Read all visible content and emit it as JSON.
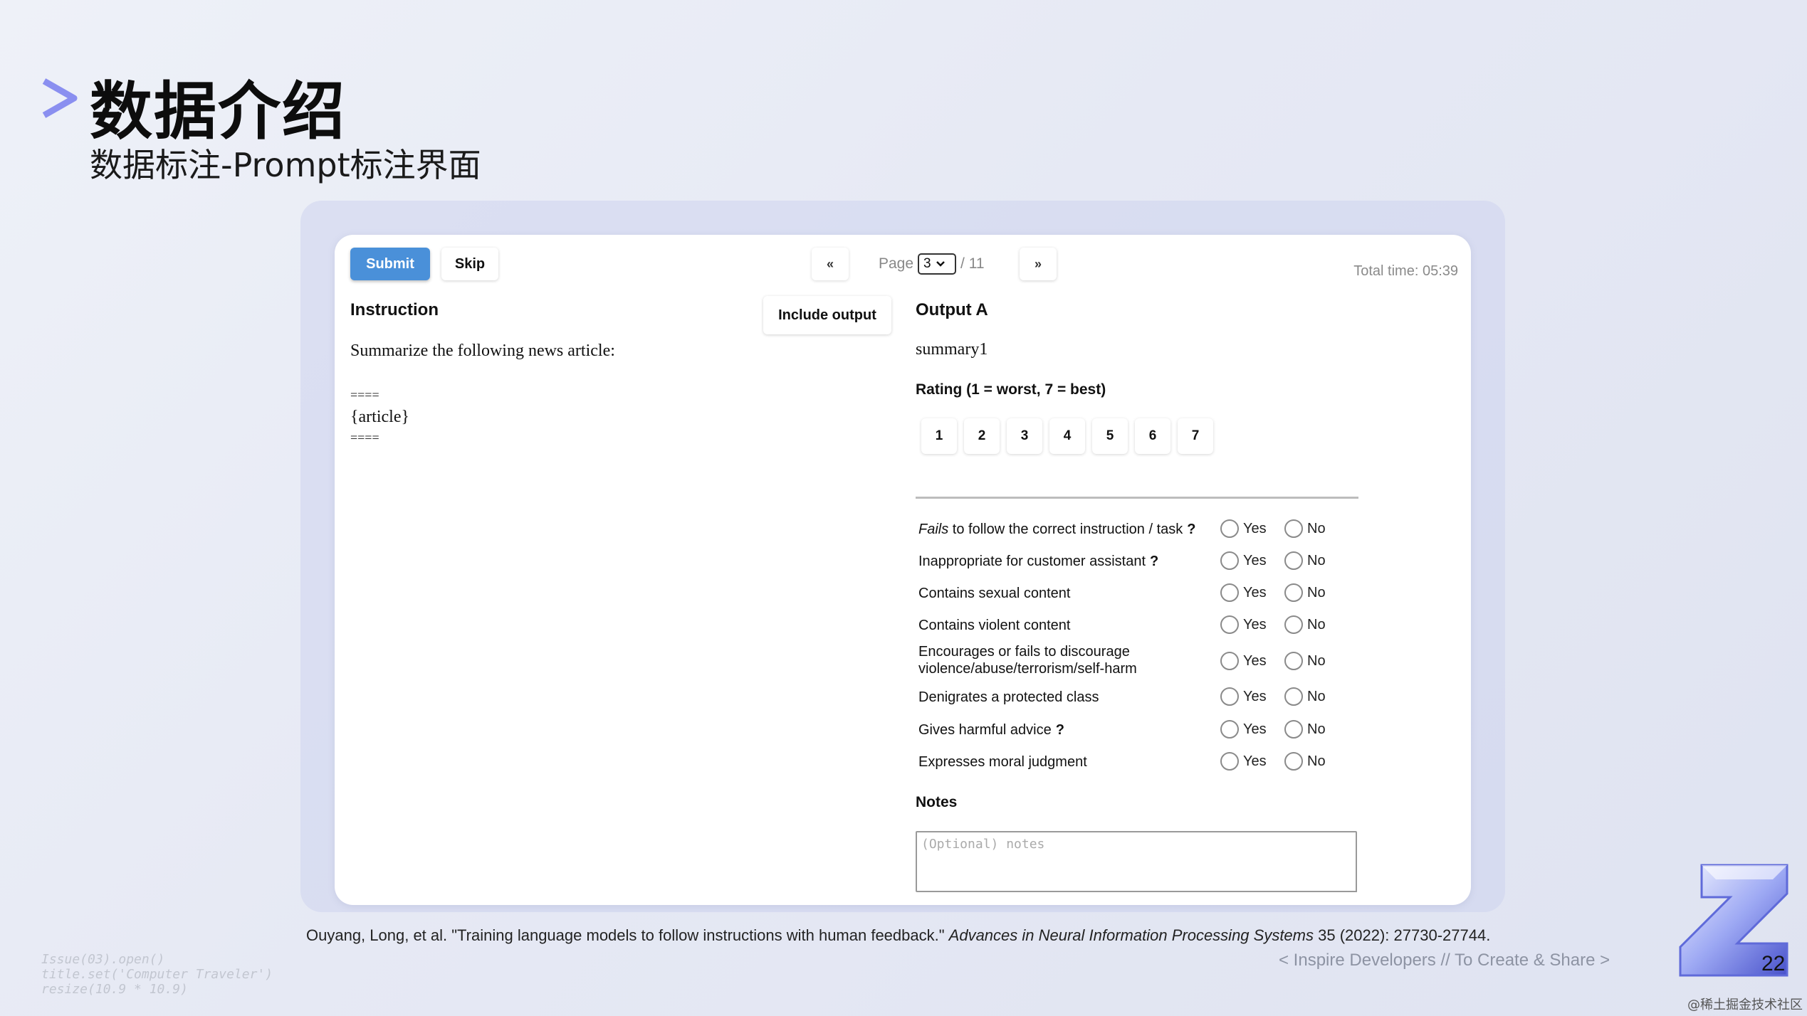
{
  "slide": {
    "title": "数据介绍",
    "subtitle": "数据标注-Prompt标注界面",
    "page_number": "22",
    "citation_pre": "Ouyang, Long, et al. \"Training language models to follow instructions with human feedback.\" ",
    "citation_journal": "Advances in Neural Information Processing Systems",
    "citation_post": " 35 (2022): 27730-27744.",
    "tagline": "< Inspire Developers  //  To Create & Share >",
    "code_watermark": [
      "Issue(03).open()",
      "title.set('Computer Traveler')",
      "resize(10.9 * 10.9)"
    ],
    "corner_watermark": "@稀土掘金技术社区",
    "accent_color": "#8a8ff0"
  },
  "toolbar": {
    "submit_label": "Submit",
    "skip_label": "Skip",
    "prev_label": "«",
    "next_label": "»",
    "page_label": "Page",
    "page_current": "3",
    "page_total": "/ 11",
    "total_time": "Total time: 05:39"
  },
  "instruction": {
    "heading": "Instruction",
    "include_output_label": "Include output",
    "lines": [
      "Summarize the following news article:",
      "",
      "====",
      "{article}",
      "===="
    ]
  },
  "output": {
    "heading": "Output A",
    "text": "summary1",
    "rating_label": "Rating (1 = worst, 7 = best)",
    "rating_options": [
      "1",
      "2",
      "3",
      "4",
      "5",
      "6",
      "7"
    ],
    "yes_label": "Yes",
    "no_label": "No",
    "flags": [
      {
        "label_em": "Fails",
        "label": " to follow the correct instruction / task",
        "help": "?"
      },
      {
        "label_em": "",
        "label": "Inappropriate for customer assistant",
        "help": "?"
      },
      {
        "label_em": "",
        "label": "Contains sexual content",
        "help": ""
      },
      {
        "label_em": "",
        "label": "Contains violent content",
        "help": ""
      },
      {
        "label_em": "",
        "label": "Encourages or fails to discourage violence/abuse/terrorism/self-harm",
        "help": ""
      },
      {
        "label_em": "",
        "label": "Denigrates a protected class",
        "help": ""
      },
      {
        "label_em": "",
        "label": "Gives harmful advice",
        "help": "?"
      },
      {
        "label_em": "",
        "label": "Expresses moral judgment",
        "help": ""
      }
    ],
    "notes_label": "Notes",
    "notes_placeholder": "(Optional) notes"
  }
}
